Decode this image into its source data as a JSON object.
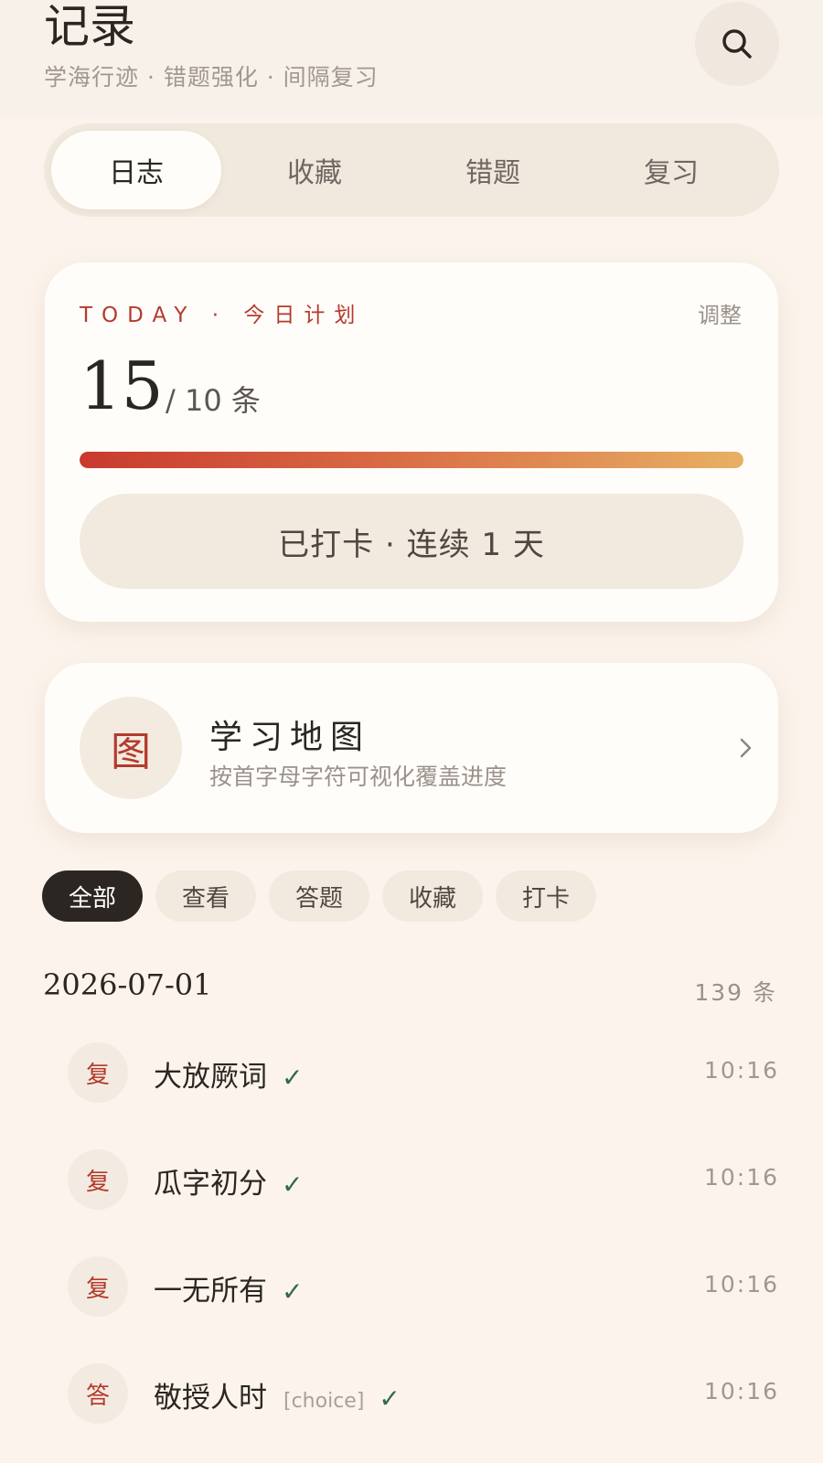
{
  "header": {
    "title": "记录",
    "subtitle": "学海行迹 · 错题强化 · 间隔复习",
    "search_icon": "search-icon"
  },
  "tabs": [
    {
      "label": "日志",
      "active": true
    },
    {
      "label": "收藏",
      "active": false
    },
    {
      "label": "错题",
      "active": false
    },
    {
      "label": "复习",
      "active": false
    }
  ],
  "plan": {
    "label": "TODAY · 今日计划",
    "adjust_label": "调整",
    "count": "15",
    "total": "/ 10 条",
    "progress": 1.0,
    "checkin_label": "已打卡 · 连续 1 天"
  },
  "map": {
    "icon_char": "图",
    "title": "学习地图",
    "description": "按首字母字符可视化覆盖进度",
    "chevron_icon": "chevron-right-icon"
  },
  "filters": [
    {
      "label": "全部",
      "active": true
    },
    {
      "label": "查看",
      "active": false
    },
    {
      "label": "答题",
      "active": false
    },
    {
      "label": "收藏",
      "active": false
    },
    {
      "label": "打卡",
      "active": false
    }
  ],
  "log": {
    "date": "2026-07-01",
    "count": "139 条",
    "items": [
      {
        "badge": "复",
        "text": "大放厥词",
        "tag": "",
        "check": "✓",
        "time": "10:16"
      },
      {
        "badge": "复",
        "text": "瓜字初分",
        "tag": "",
        "check": "✓",
        "time": "10:16"
      },
      {
        "badge": "复",
        "text": "一无所有",
        "tag": "",
        "check": "✓",
        "time": "10:16"
      },
      {
        "badge": "答",
        "text": "敬授人时",
        "tag": "[choice]",
        "check": "✓",
        "time": "10:16"
      }
    ]
  },
  "colors": {
    "background": "#FCF4EC",
    "accent_red": "#B53A2C",
    "check_green": "#2F6B47",
    "progress_start": "#C83A2E",
    "progress_end": "#E8B064"
  }
}
